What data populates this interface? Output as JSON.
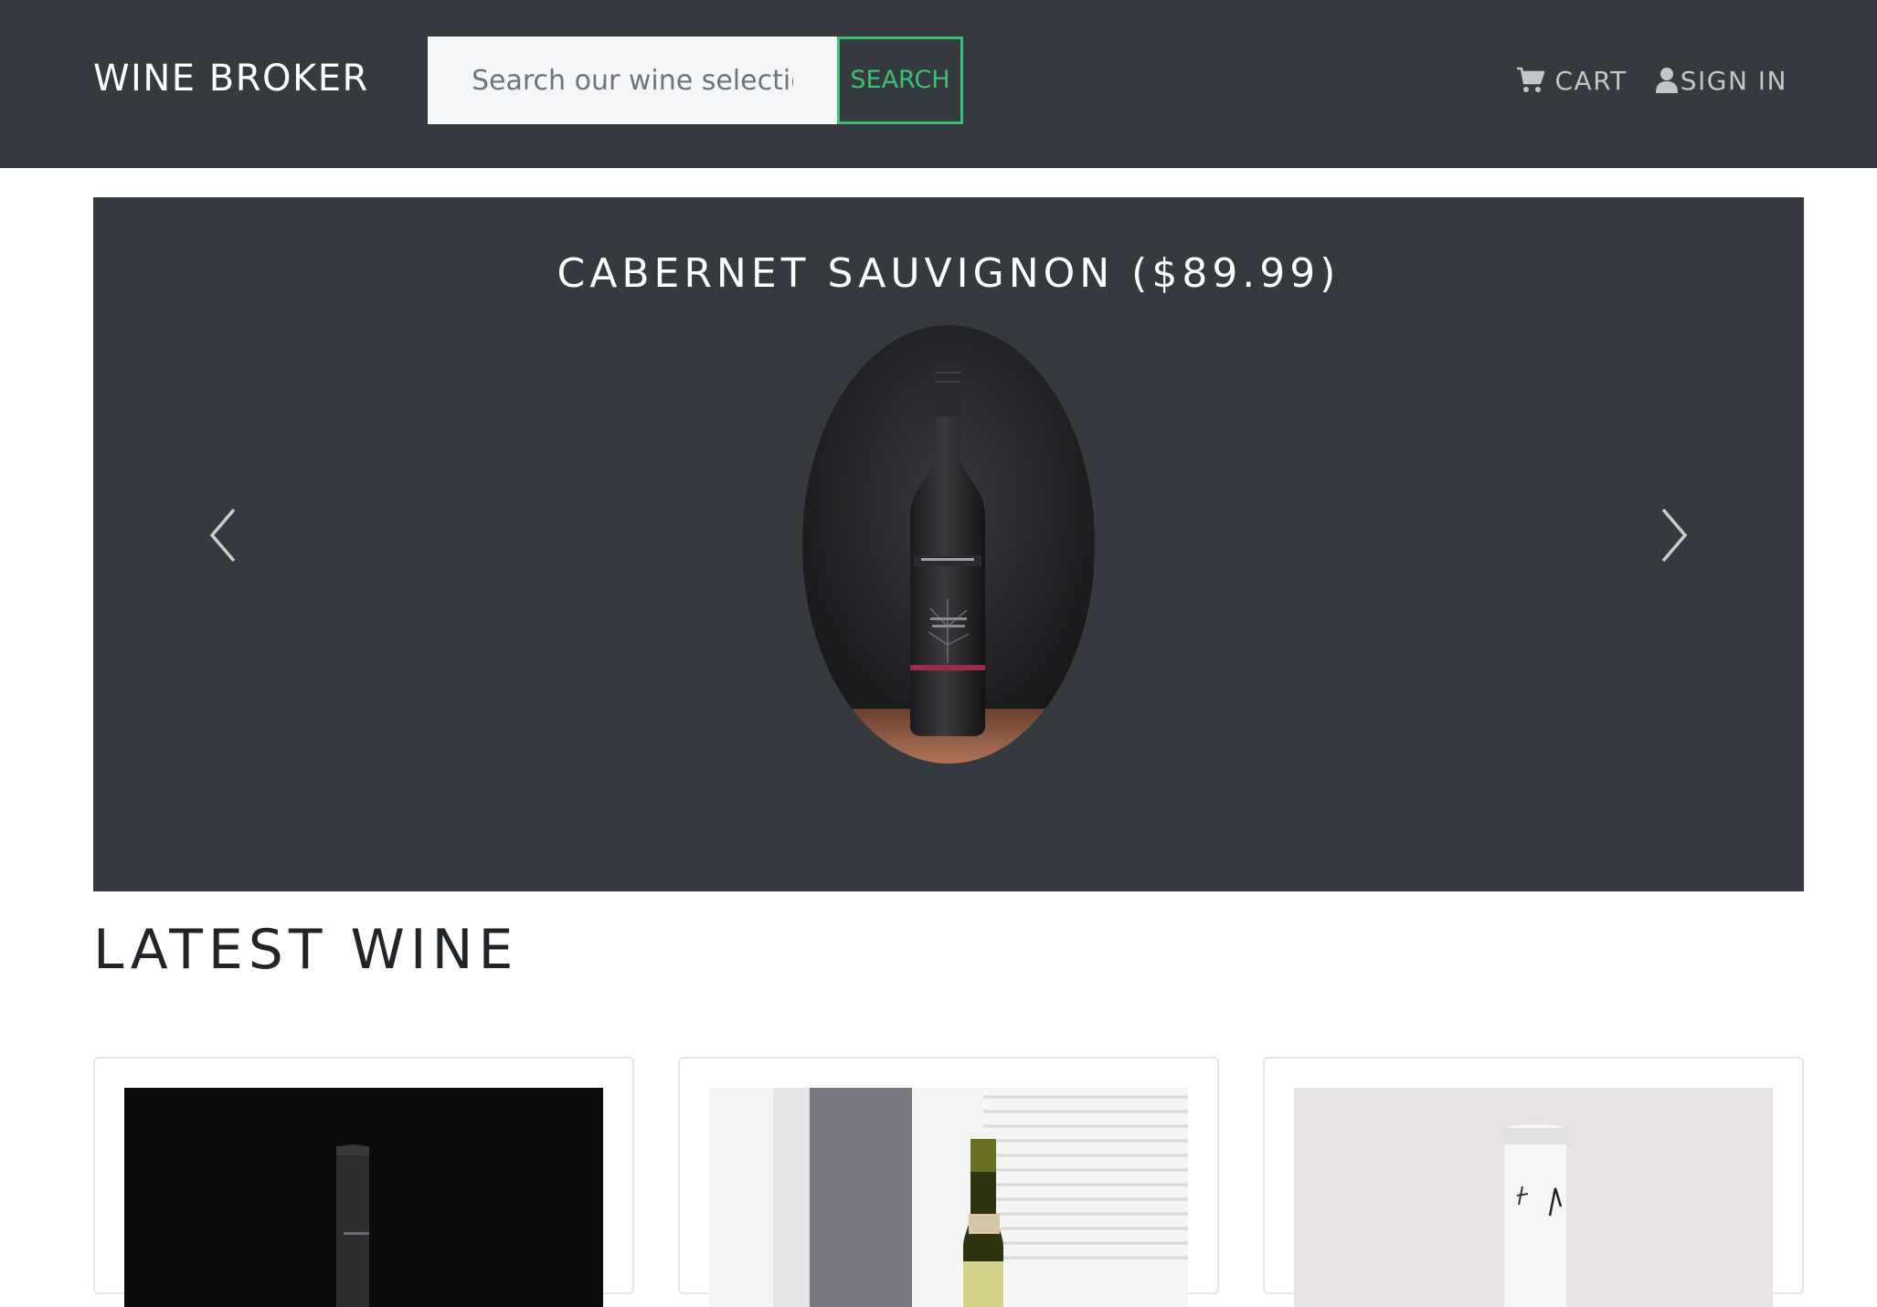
{
  "header": {
    "brand": "WINE BROKER",
    "search_placeholder": "Search our wine selection",
    "search_button": "SEARCH",
    "cart_label": "CART",
    "signin_label": "SIGN IN"
  },
  "carousel": {
    "slide_title": "CABERNET SAUVIGNON ($89.99)"
  },
  "latest": {
    "title": "LATEST WINE"
  },
  "colors": {
    "navbar_bg": "#343a40",
    "accent_green": "#3fbf72",
    "text_dark": "#212529"
  },
  "icons": {
    "cart": "shopping-cart-icon",
    "user": "user-icon",
    "prev": "chevron-left-icon",
    "next": "chevron-right-icon"
  }
}
